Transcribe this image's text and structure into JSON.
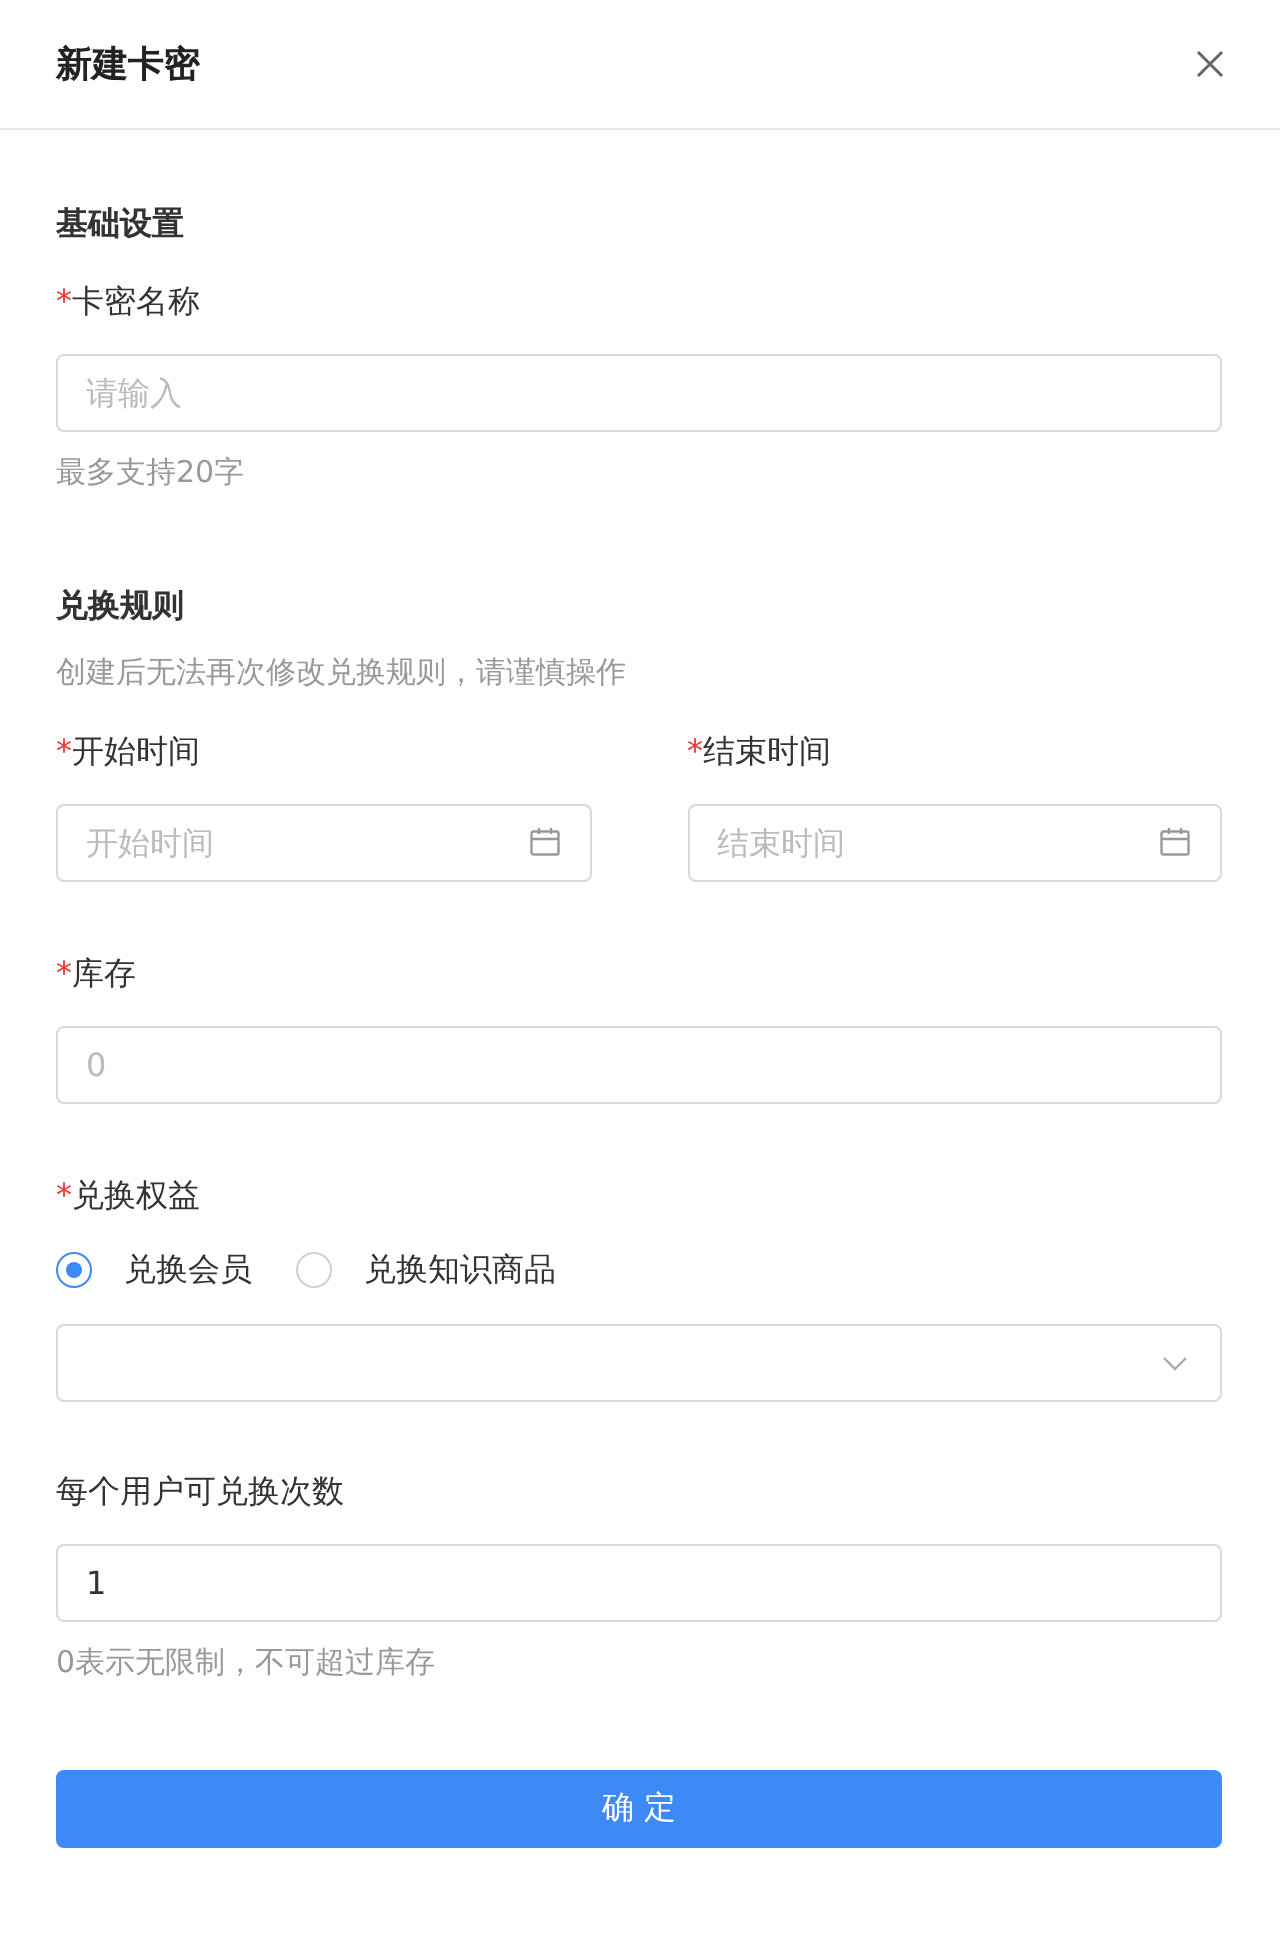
{
  "title": "新建卡密",
  "basic": {
    "heading": "基础设置",
    "name_field": {
      "label": "卡密名称",
      "required_mark": "*",
      "placeholder": "请输入",
      "hint": "最多支持20字"
    }
  },
  "rules": {
    "heading": "兑换规则",
    "description": "创建后无法再次修改兑换规则，请谨慎操作",
    "start": {
      "label": "开始时间",
      "required_mark": "*",
      "placeholder": "开始时间"
    },
    "end": {
      "label": "结束时间",
      "required_mark": "*",
      "placeholder": "结束时间"
    },
    "stock": {
      "label": "库存",
      "required_mark": "*",
      "placeholder": "0"
    },
    "benefit": {
      "label": "兑换权益",
      "required_mark": "*",
      "options": [
        {
          "label": "兑换会员",
          "selected": true
        },
        {
          "label": "兑换知识商品",
          "selected": false
        }
      ]
    },
    "limit": {
      "label": "每个用户可兑换次数",
      "value": "1",
      "hint": "0表示无限制，不可超过库存"
    }
  },
  "submit": "确 定"
}
